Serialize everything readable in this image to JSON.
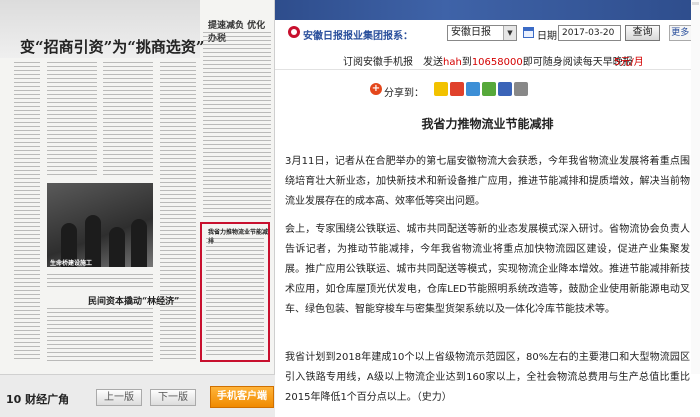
{
  "paper": {
    "headline": "变“招商引资”为“挑商选资”",
    "side_head": "提速减负 优化办税",
    "photo_caption": "生命桥建设施工",
    "sub_head": "民间资本撬动“林经济”",
    "highlight_title": "我省力推物流业节能减排"
  },
  "bottom_nav": {
    "page_label": "10 财经广角",
    "prev_label": "上一版",
    "next_label": "下一版",
    "mobile_label": "手机客户端"
  },
  "search": {
    "label": "安徽日报报业集团报系：",
    "paper_select": "安徽日报",
    "date_label": "日期",
    "date_value": "2017-03-20",
    "query_label": "查询",
    "more_label": "更多"
  },
  "promo": {
    "part1": "订阅安徽手机报",
    "part2a": "发送",
    "part2b": "hah",
    "part2c": "到",
    "part2d": "10658000",
    "part2e": "即可随身阅读每天早晚报",
    "price": "5元/月"
  },
  "share": {
    "label": "分享到："
  },
  "article": {
    "title": "我省力推物流业节能减排",
    "paragraphs": [
      "3月11日，记者从在合肥举办的第七届安徽物流大会获悉，今年我省物流业发展将着重点围绕培育壮大新业态，加快新技术和新设备推广应用，推进节能减排和提质增效，解决当前物流业发展存在的成本高、效率低等突出问题。",
      "会上，专家围绕公铁联运、城市共同配送等新的业态发展模式深入研讨。省物流协会负责人告诉记者，为推动节能减排，今年我省物流业将重点加快物流园区建设，促进产业集聚发展。推广应用公铁联运、城市共同配送等模式，实现物流企业降本增效。推进节能减排新技术应用，如仓库屋顶光伏发电，仓库LED节能照明系统改造等，鼓励企业使用新能源电动叉车、绿色包装、智能穿梭车与密集型货架系统以及一体化冷库节能技术等。",
      "我省计划到2018年建成10个以上省级物流示范园区，80%左右的主要港口和大型物流园区引入铁路专用线，A级以上物流企业达到160家以上，全社会物流总费用与生产总值比重比2015年降低1个百分点以上。（史力）"
    ]
  }
}
